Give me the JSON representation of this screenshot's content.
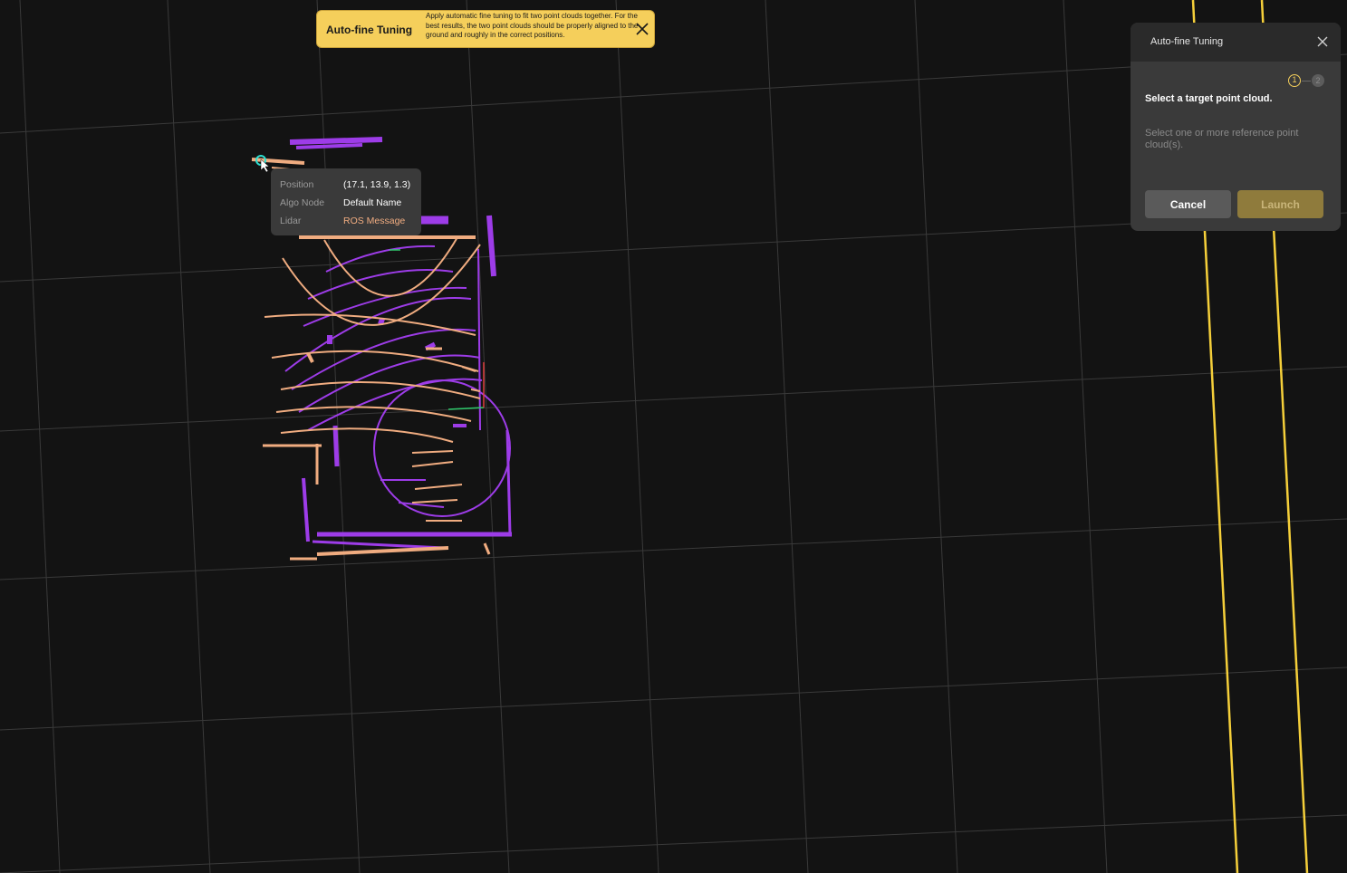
{
  "hint_banner": {
    "title": "Auto-fine Tuning",
    "text": "Apply automatic fine tuning to fit two point clouds together. For the best results, the two point clouds should be properly aligned to the ground and roughly in the correct positions.",
    "close_icon": "close-icon"
  },
  "tooltip": {
    "position_label": "Position",
    "position_value": "(17.1, 13.9, 1.3)",
    "algo_node_label": "Algo Node",
    "algo_node_value": "Default Name",
    "lidar_label": "Lidar",
    "lidar_value": "ROS Message"
  },
  "panel": {
    "title": "Auto-fine Tuning",
    "close_icon": "close-icon",
    "steps": [
      {
        "number": "1",
        "state": "active"
      },
      {
        "number": "2",
        "state": "inactive"
      }
    ],
    "step1_text": "Select a target point cloud.",
    "step2_text": "Select one or more reference point cloud(s).",
    "cancel_label": "Cancel",
    "launch_label": "Launch"
  },
  "colors": {
    "background": "#131313",
    "grid": "#3a3a3a",
    "point_cloud_orange": "#f0ac80",
    "point_cloud_purple": "#9d3ce8",
    "trajectory": "#f5cf3a",
    "accent": "#f5cf5b"
  }
}
